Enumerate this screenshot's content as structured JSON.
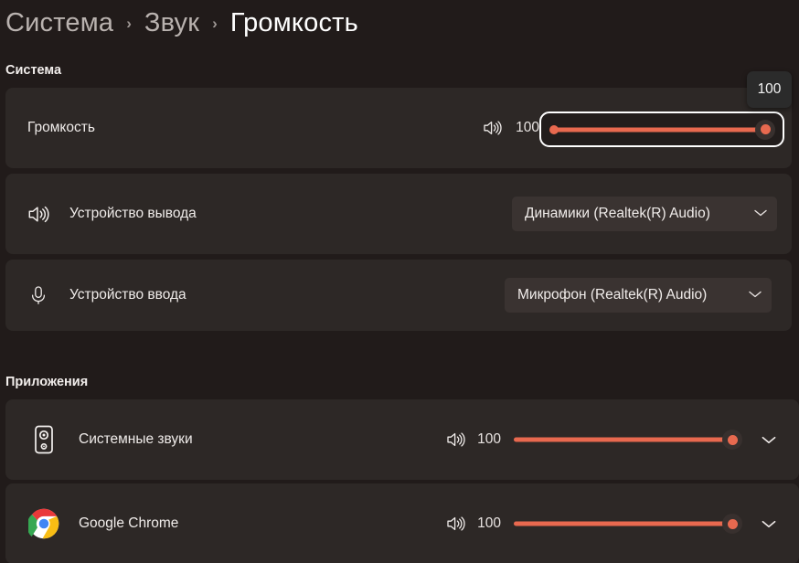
{
  "breadcrumb": {
    "items": [
      {
        "label": "Система",
        "current": false
      },
      {
        "label": "Звук",
        "current": false
      },
      {
        "label": "Громкость",
        "current": true
      }
    ],
    "separator": "›"
  },
  "sections": {
    "system": {
      "label": "Система"
    },
    "apps": {
      "label": "Приложения"
    }
  },
  "volume_row": {
    "label": "Громкость",
    "value": "100",
    "tooltip": "100",
    "speaker_icon": "speaker-wave-icon",
    "focused": true
  },
  "output_row": {
    "label": "Устройство вывода",
    "icon": "speaker-wave-icon",
    "selected": "Динамики (Realtek(R) Audio)",
    "chevron": "chevron-down-icon"
  },
  "input_row": {
    "label": "Устройство ввода",
    "icon": "microphone-icon",
    "selected": "Микрофон (Realtek(R) Audio)",
    "chevron": "chevron-down-icon"
  },
  "apps": [
    {
      "name": "Системные звуки",
      "icon": "speaker-box-icon",
      "value": "100",
      "speaker_icon": "speaker-wave-icon",
      "expand_icon": "chevron-down-icon"
    },
    {
      "name": "Google Chrome",
      "icon": "chrome-logo-icon",
      "value": "100",
      "speaker_icon": "speaker-wave-icon",
      "expand_icon": "chevron-down-icon"
    }
  ],
  "colors": {
    "accent": "#e8694f",
    "page_background": "#211b1a",
    "card_background": "#2d2826",
    "control_background": "#3a3331",
    "focus_ring": "#ffffff",
    "text_primary": "#f0ecea",
    "text_muted": "#b9b2af",
    "tooltip_background": "#2b2b2b"
  }
}
